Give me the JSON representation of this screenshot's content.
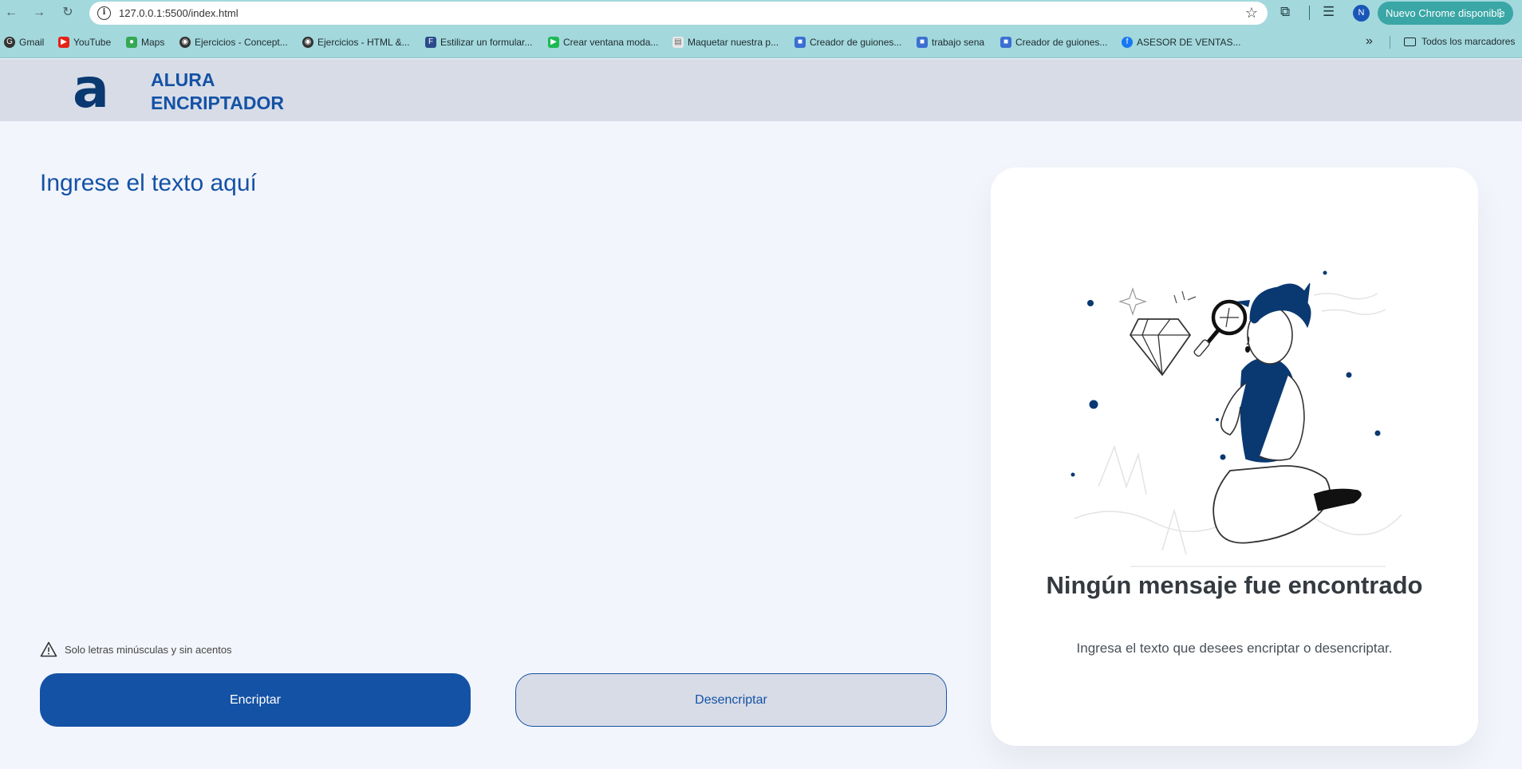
{
  "browser": {
    "url": "127.0.0.1:5500/index.html",
    "profile_initial": "N",
    "update_label": "Nuevo Chrome disponible",
    "bookmarks": [
      {
        "label": "Gmail",
        "icon": "google-icon"
      },
      {
        "label": "YouTube",
        "icon": "youtube-icon"
      },
      {
        "label": "Maps",
        "icon": "maps-icon"
      },
      {
        "label": "Ejercicios - Concept...",
        "icon": "globe-icon"
      },
      {
        "label": "Ejercicios - HTML &...",
        "icon": "globe-icon"
      },
      {
        "label": "Estilizar un formular...",
        "icon": "fr-icon"
      },
      {
        "label": "Crear ventana moda...",
        "icon": "play-icon"
      },
      {
        "label": "Maquetar nuestra p...",
        "icon": "doc-icon"
      },
      {
        "label": "Creador de guiones...",
        "icon": "slides-icon"
      },
      {
        "label": "trabajo sena",
        "icon": "slides-icon"
      },
      {
        "label": "Creador de guiones...",
        "icon": "slides-icon"
      },
      {
        "label": "ASESOR DE VENTAS...",
        "icon": "facebook-icon"
      }
    ],
    "all_bookmarks_label": "Todos los marcadores"
  },
  "header": {
    "logo": "a",
    "brand_line1": "ALURA",
    "brand_line2": "ENCRIPTADOR"
  },
  "main": {
    "input_placeholder": "Ingrese el texto aquí",
    "warning_text": "Solo letras minúsculas y sin acentos",
    "encrypt_label": "Encriptar",
    "decrypt_label": "Desencriptar"
  },
  "output": {
    "title": "Ningún mensaje fue encontrado",
    "subtitle": "Ingresa el texto que desees encriptar o desencriptar."
  },
  "colors": {
    "primary": "#1452a6",
    "dark_blue": "#0a3871",
    "chrome": "#a3d8dd",
    "header_bg": "#d8dce6",
    "page_bg": "#f3f5fc"
  }
}
